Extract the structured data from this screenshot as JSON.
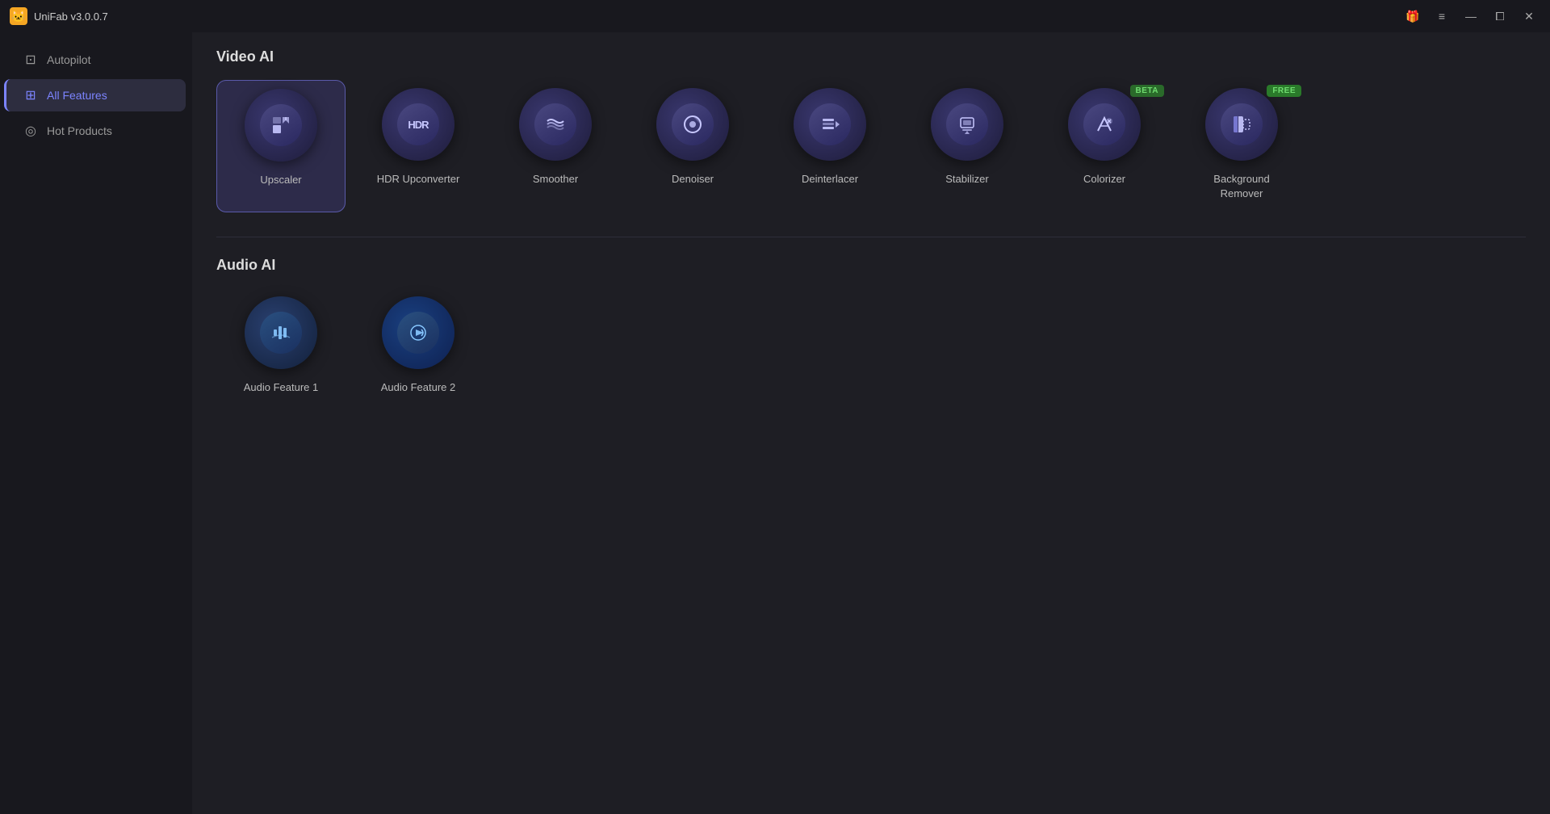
{
  "titlebar": {
    "title": "UniFab v3.0.0.7",
    "app_icon": "🐱",
    "controls": [
      {
        "name": "gift-icon",
        "symbol": "🎁",
        "label": "Gift"
      },
      {
        "name": "menu-icon",
        "symbol": "≡",
        "label": "Menu"
      },
      {
        "name": "minimize-icon",
        "symbol": "—",
        "label": "Minimize"
      },
      {
        "name": "maximize-icon",
        "symbol": "⧠",
        "label": "Maximize"
      },
      {
        "name": "close-icon",
        "symbol": "✕",
        "label": "Close"
      }
    ]
  },
  "sidebar": {
    "items": [
      {
        "id": "autopilot",
        "label": "Autopilot",
        "icon": "⊡",
        "active": false
      },
      {
        "id": "all-features",
        "label": "All Features",
        "icon": "⊞",
        "active": true
      },
      {
        "id": "hot-products",
        "label": "Hot Products",
        "icon": "◎",
        "active": false
      }
    ]
  },
  "video_ai": {
    "section_title": "Video AI",
    "features": [
      {
        "id": "upscaler",
        "label": "Upscaler",
        "icon": "⤢",
        "badge": null,
        "selected": true
      },
      {
        "id": "hdr-upconverter",
        "label": "HDR Upconverter",
        "icon": "HDR",
        "badge": null,
        "selected": false
      },
      {
        "id": "smoother",
        "label": "Smoother",
        "icon": "≋",
        "badge": null,
        "selected": false
      },
      {
        "id": "denoiser",
        "label": "Denoiser",
        "icon": "◑",
        "badge": null,
        "selected": false
      },
      {
        "id": "deinterlacer",
        "label": "Deinterlacer",
        "icon": "▶",
        "badge": null,
        "selected": false
      },
      {
        "id": "stabilizer",
        "label": "Stabilizer",
        "icon": "⊡",
        "badge": null,
        "selected": false
      },
      {
        "id": "colorizer",
        "label": "Colorizer",
        "icon": "✂",
        "badge": "BETA",
        "selected": false
      },
      {
        "id": "background-remover",
        "label": "Background\nRemover",
        "icon": "▧",
        "badge": "FREE",
        "selected": false
      }
    ]
  },
  "audio_ai": {
    "section_title": "Audio AI",
    "features": [
      {
        "id": "audio-1",
        "label": "Audio Feature 1",
        "icon": "📊",
        "badge": null
      },
      {
        "id": "audio-2",
        "label": "Audio Feature 2",
        "icon": "🔊",
        "badge": null
      }
    ]
  }
}
